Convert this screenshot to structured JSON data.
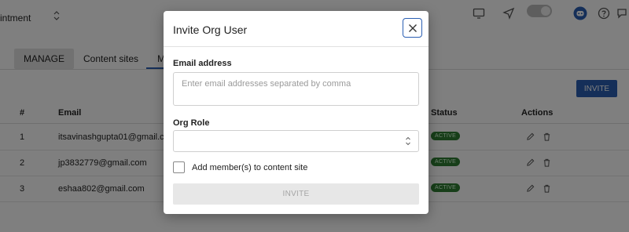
{
  "header": {
    "org_name": "intment"
  },
  "tabs": [
    {
      "label": "Manage"
    },
    {
      "label": "Content sites"
    },
    {
      "label": "M"
    }
  ],
  "toolbar": {
    "invite_label": "INVITE"
  },
  "table": {
    "columns": [
      "#",
      "Email",
      "Status",
      "Actions"
    ],
    "rows": [
      {
        "index": "1",
        "email": "itsavinashgupta01@gmail.co",
        "status": "ACTIVE"
      },
      {
        "index": "2",
        "email": "jp3832779@gmail.com",
        "status": "ACTIVE"
      },
      {
        "index": "3",
        "email": "eshaa802@gmail.com",
        "status": "ACTIVE"
      }
    ]
  },
  "modal": {
    "title": "Invite Org User",
    "email_label": "Email address",
    "email_placeholder": "Enter email addresses separated by comma",
    "email_value": "",
    "role_label": "Org Role",
    "role_value": "",
    "checkbox_label": "Add member(s) to content site",
    "checkbox_checked": false,
    "invite_label": "INVITE"
  },
  "colors": {
    "accent": "#2b5fb3",
    "status_active": "#2e7d32",
    "overlay": "rgba(0,0,0,0.5)"
  },
  "icons": [
    "chevron-updown-icon",
    "screen-icon",
    "send-icon",
    "toggle",
    "discord-icon",
    "help-icon",
    "chat-icon",
    "edit-icon",
    "trash-icon",
    "close-icon"
  ]
}
